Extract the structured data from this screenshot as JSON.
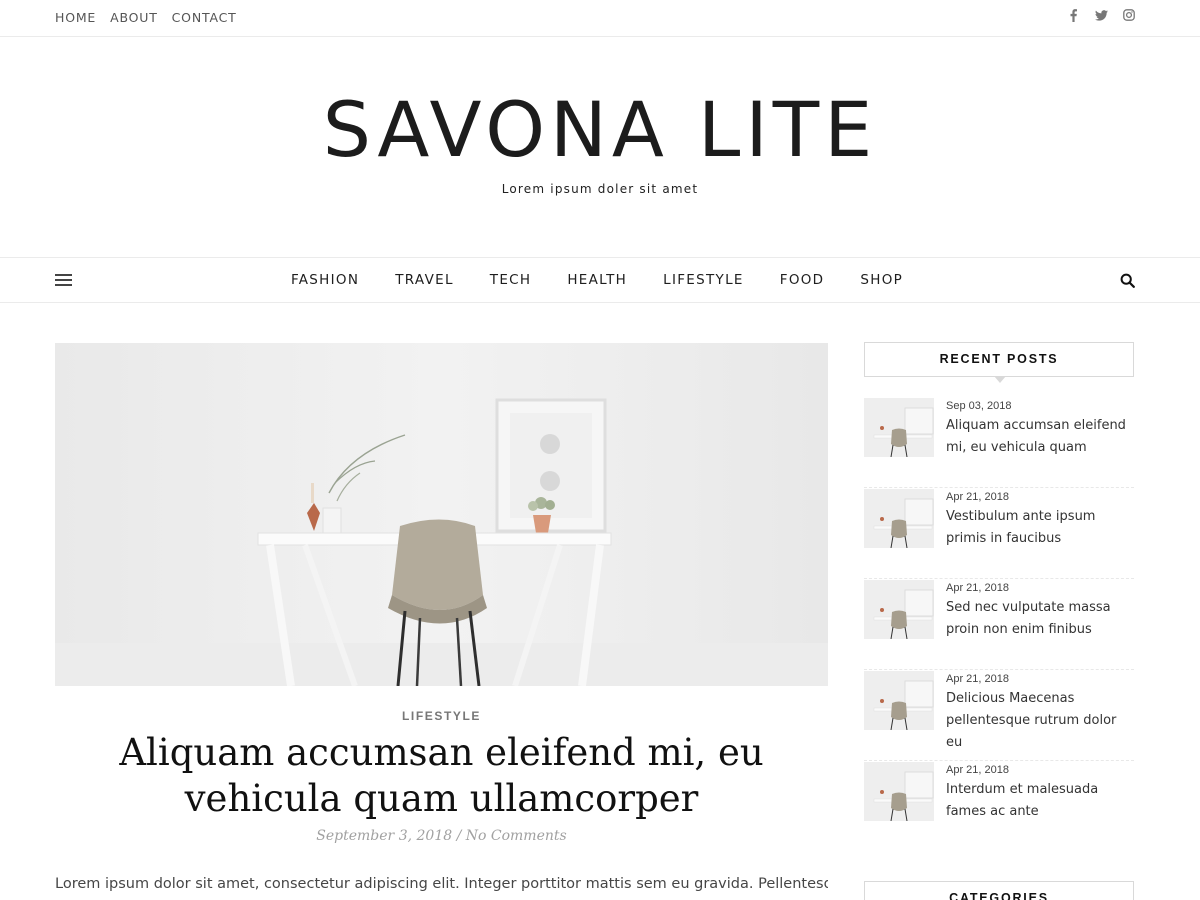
{
  "top_menu": {
    "items": [
      "HOME",
      "ABOUT",
      "CONTACT"
    ]
  },
  "social_icons": [
    "facebook-icon",
    "twitter-icon",
    "instagram-icon"
  ],
  "brand": {
    "title": "SAVONA LITE",
    "tagline": "Lorem ipsum doler sit amet"
  },
  "main_nav": {
    "items": [
      "FASHION",
      "TRAVEL",
      "TECH",
      "HEALTH",
      "LIFESTYLE",
      "FOOD",
      "SHOP"
    ]
  },
  "featured_post": {
    "category": "LIFESTYLE",
    "title": "Aliquam accumsan eleifend mi, eu vehicula quam ullamcorper",
    "date": "September 3, 2018",
    "separator": " / ",
    "comments": "No Comments",
    "excerpt": "Lorem ipsum dolor sit amet, consectetur adipiscing elit. Integer porttitor mattis sem eu gravida. Pellentesque"
  },
  "sidebar": {
    "recent_posts": {
      "title": "RECENT POSTS",
      "items": [
        {
          "date": "Sep 03, 2018",
          "title": "Aliquam accumsan eleifend mi, eu vehicula quam"
        },
        {
          "date": "Apr 21, 2018",
          "title": "Vestibulum ante ipsum primis in faucibus"
        },
        {
          "date": "Apr 21, 2018",
          "title": "Sed nec vulputate massa proin non enim finibus"
        },
        {
          "date": "Apr 21, 2018",
          "title": "Delicious Maecenas pellentesque rutrum dolor eu"
        },
        {
          "date": "Apr 21, 2018",
          "title": "Interdum et malesuada fames ac ante"
        }
      ]
    },
    "categories": {
      "title": "CATEGORIES"
    }
  },
  "colors": {
    "text": "#333333",
    "border": "#ebebeb",
    "meta": "#a1a1a1"
  }
}
